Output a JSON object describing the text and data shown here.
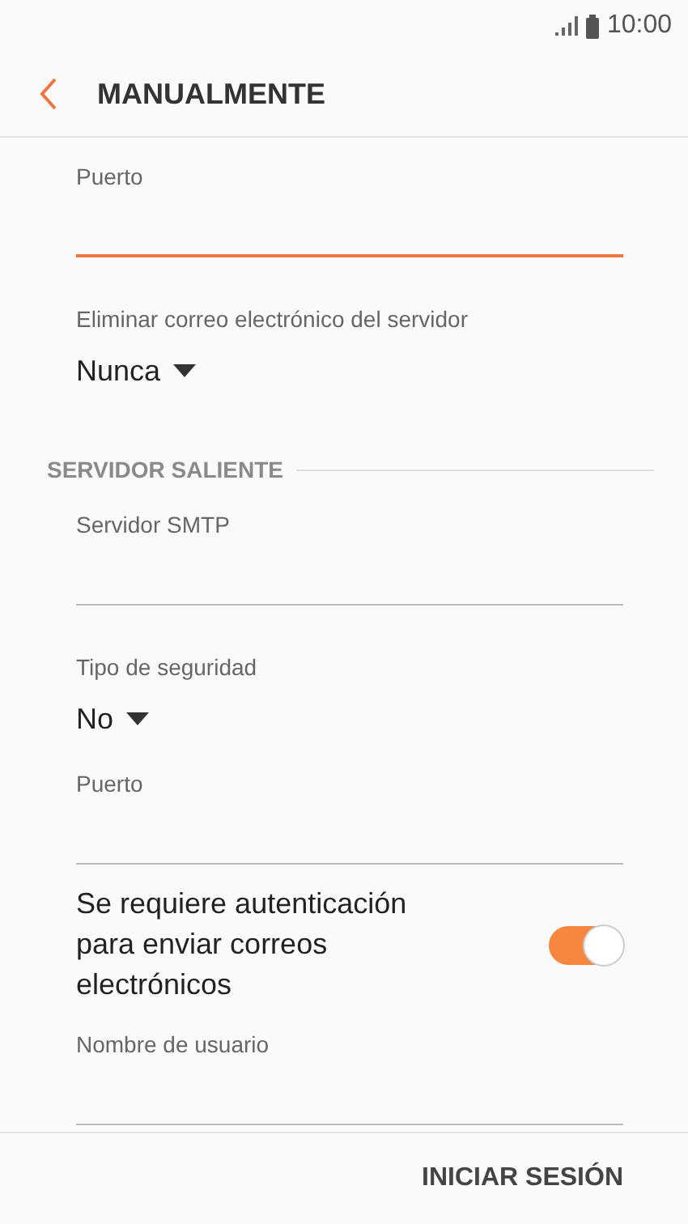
{
  "status_bar": {
    "time": "10:00"
  },
  "header": {
    "title": "MANUALMENTE"
  },
  "items": [
    {
      "kind": "field",
      "label": "Puerto",
      "focused": true
    },
    {
      "kind": "dropdown",
      "label": "Eliminar correo electrónico del servidor",
      "value": "Nunca"
    },
    {
      "kind": "section",
      "label": "SERVIDOR SALIENTE"
    },
    {
      "kind": "field",
      "label": "Servidor SMTP",
      "focused": false
    },
    {
      "kind": "dropdown",
      "label": "Tipo de seguridad",
      "value": "No"
    },
    {
      "kind": "field",
      "label": "Puerto",
      "focused": false
    },
    {
      "kind": "toggle",
      "label": "Se requiere autenticación para enviar correos electrónicos",
      "on": true
    },
    {
      "kind": "field",
      "label": "Nombre de usuario",
      "focused": false
    }
  ],
  "footer": {
    "button": "INICIAR SESIÓN"
  }
}
